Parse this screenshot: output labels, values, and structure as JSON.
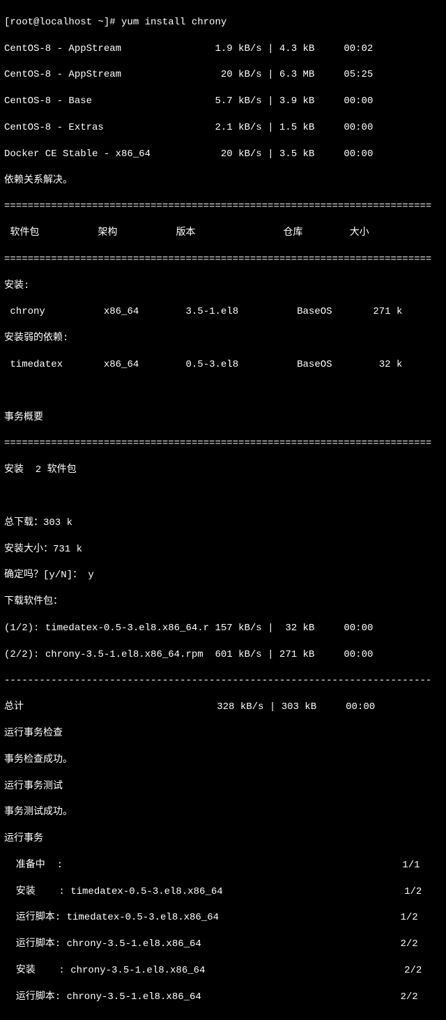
{
  "prompt": "[root@localhost ~]# ",
  "command": "yum install chrony",
  "repos": [
    {
      "name": "CentOS-8 - AppStream",
      "rate": "1.9 kB/s",
      "size": "4.3 kB",
      "time": "00:02"
    },
    {
      "name": "CentOS-8 - AppStream",
      "rate": " 20 kB/s",
      "size": "6.3 MB",
      "time": "05:25"
    },
    {
      "name": "CentOS-8 - Base",
      "rate": "5.7 kB/s",
      "size": "3.9 kB",
      "time": "00:00"
    },
    {
      "name": "CentOS-8 - Extras",
      "rate": "2.1 kB/s",
      "size": "1.5 kB",
      "time": "00:00"
    },
    {
      "name": "Docker CE Stable - x86_64",
      "rate": " 20 kB/s",
      "size": "3.5 kB",
      "time": "00:00"
    }
  ],
  "dep_resolved": "依赖关系解决。",
  "sep_eq": "=========================================================================",
  "sep_dash": "-------------------------------------------------------------------------",
  "hdr": {
    "pkg": "软件包",
    "arch": "架构",
    "ver": "版本",
    "repo": "仓库",
    "size": "大小"
  },
  "installing_label": "安装:",
  "pkg1": {
    "name": "chrony",
    "arch": "x86_64",
    "ver": "3.5-1.el8",
    "repo": "BaseOS",
    "size": "271 k"
  },
  "weak_label": "安装弱的依赖:",
  "pkg2": {
    "name": "timedatex",
    "arch": "x86_64",
    "ver": "0.5-3.el8",
    "repo": "BaseOS",
    "size": " 32 k"
  },
  "summary_label": "事务概要",
  "install_count": "安装  2 软件包",
  "total_download": "总下载：303 k",
  "installed_size": "安装大小：731 k",
  "confirm_prompt": "确定吗？[y/N]： ",
  "confirm_answer": "y",
  "downloading_label": "下载软件包：",
  "dl1": {
    "idx": "(1/2):",
    "file": "timedatex-0.5-3.el8.x86_64.r",
    "rate": "157 kB/s",
    "size": " 32 kB",
    "time": "00:00"
  },
  "dl2": {
    "idx": "(2/2):",
    "file": "chrony-3.5-1.el8.x86_64.rpm",
    "rate": "601 kB/s",
    "size": "271 kB",
    "time": "00:00"
  },
  "total_label": "总计",
  "total_rate": "328 kB/s",
  "total_size": "303 kB",
  "total_time": "00:00",
  "run_check": "运行事务检查",
  "check_ok": "事务检查成功。",
  "run_test": "运行事务测试",
  "test_ok": "事务测试成功。",
  "run_trans": "运行事务",
  "steps": [
    {
      "label": "  准备中  :",
      "count": "1/1"
    },
    {
      "label": "  安装    : timedatex-0.5-3.el8.x86_64",
      "count": "1/2"
    },
    {
      "label": "  运行脚本: timedatex-0.5-3.el8.x86_64",
      "count": "1/2"
    },
    {
      "label": "  运行脚本: chrony-3.5-1.el8.x86_64",
      "count": "2/2"
    },
    {
      "label": "  安装    : chrony-3.5-1.el8.x86_64",
      "count": "2/2"
    },
    {
      "label": "  运行脚本: chrony-3.5-1.el8.x86_64",
      "count": "2/2"
    }
  ]
}
